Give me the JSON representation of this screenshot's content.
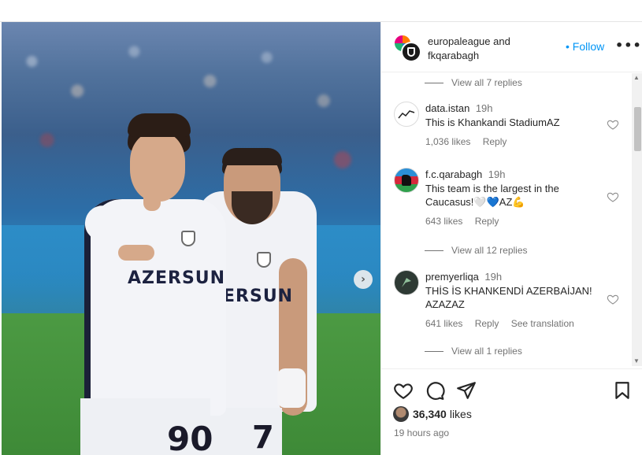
{
  "post": {
    "owner_primary": "europaleague",
    "owner_joiner": "and",
    "owner_secondary": "fkqarabagh",
    "follow_label": "Follow",
    "follow_dot": "•",
    "more_label": "•••"
  },
  "photo": {
    "sponsor_text": "AZERSUN",
    "sponsor_text_back": "ERSUN",
    "number_front": "90",
    "number_back": "7",
    "next_glyph": "›"
  },
  "comments": [
    {
      "type": "replies",
      "label": "View all 7 replies"
    },
    {
      "type": "comment",
      "user": "data.istan",
      "time": "19h",
      "text": "This is Khankandi StadiumAZ",
      "likes": "1,036 likes",
      "reply": "Reply",
      "avatar": "data-istan-logo"
    },
    {
      "type": "comment",
      "user": "f.c.qarabagh",
      "time": "19h",
      "text": "This team is the largest in the Caucasus!🤍💙AZ💪",
      "likes": "643 likes",
      "reply": "Reply",
      "avatar": "azerbaijan-flag-horse"
    },
    {
      "type": "replies",
      "label": "View all 12 replies"
    },
    {
      "type": "comment",
      "user": "premyerliqa",
      "time": "19h",
      "text": "THİS İS KHANKENDİ AZERBAİJAN! AZAZAZ",
      "likes": "641 likes",
      "reply": "Reply",
      "translate": "See translation",
      "avatar": "premyer-liqa-logo"
    },
    {
      "type": "replies",
      "label": "View all 1 replies"
    }
  ],
  "footer": {
    "like_count": "36,340",
    "likes_word": "likes",
    "time_ago": "19 hours ago"
  },
  "colors": {
    "accent": "#0095f6",
    "muted": "#737373",
    "text": "#262626"
  }
}
